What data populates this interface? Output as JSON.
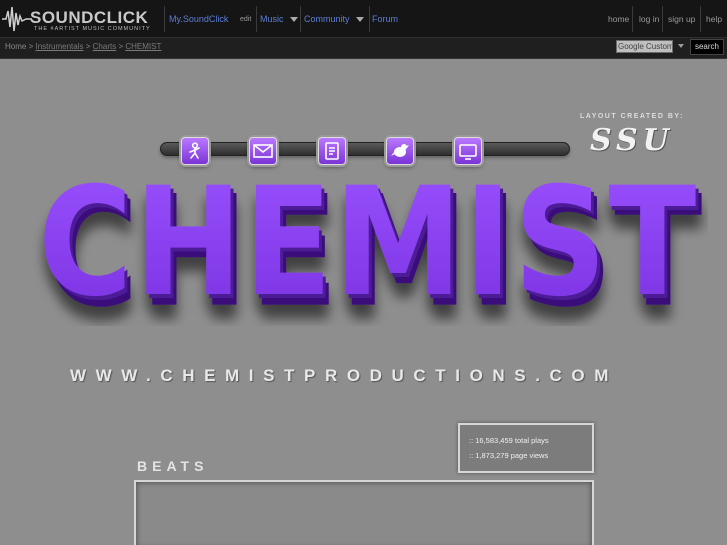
{
  "header": {
    "logo_text": "SOUNDCLICK",
    "logo_tagline": "THE #ARTIST MUSIC COMMUNITY",
    "nav": {
      "my_soundclick": "My.SoundClick",
      "edit": "edit",
      "music": "Music",
      "community": "Community",
      "forum": "Forum"
    },
    "right": {
      "home": "home",
      "login": "log in",
      "signup": "sign up",
      "help": "help"
    }
  },
  "breadcrumb": {
    "home": "Home",
    "sep": ">",
    "items": [
      "Instrumentals",
      "Charts",
      "CHEMIST"
    ]
  },
  "search": {
    "placeholder": "Google Custom",
    "button": "search"
  },
  "banner": {
    "credit_label": "LAYOUT CREATED BY:",
    "credit_name": "SSU",
    "title": "CHEMIST",
    "url": "WWW.CHEMISTPRODUCTIONS.COM",
    "icons": [
      "profile-icon",
      "mail-icon",
      "notes-icon",
      "twitter-icon",
      "tv-icon"
    ],
    "accent_color": "#8a3df0"
  },
  "stats": {
    "plays": ":: 16,583,459 total plays",
    "views": ":: 1,873,279 page views"
  },
  "sections": {
    "beats": "BEATS"
  }
}
